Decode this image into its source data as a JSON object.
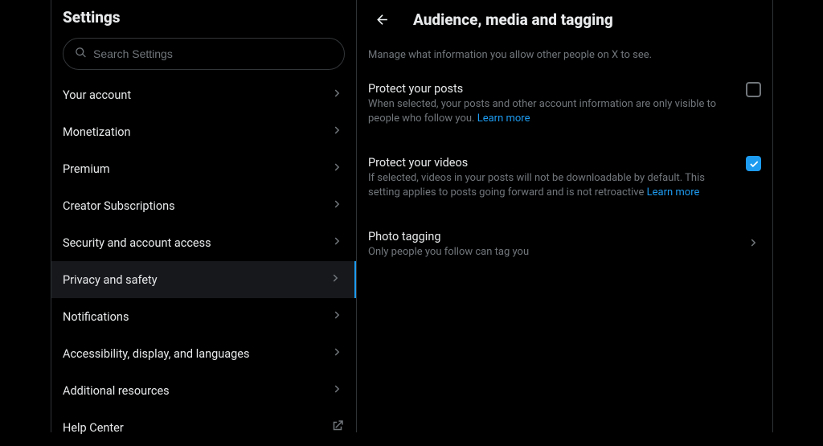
{
  "left": {
    "title": "Settings",
    "search_placeholder": "Search Settings",
    "items": [
      {
        "label": "Your account",
        "kind": "nav"
      },
      {
        "label": "Monetization",
        "kind": "nav"
      },
      {
        "label": "Premium",
        "kind": "nav"
      },
      {
        "label": "Creator Subscriptions",
        "kind": "nav"
      },
      {
        "label": "Security and account access",
        "kind": "nav"
      },
      {
        "label": "Privacy and safety",
        "kind": "nav",
        "active": true
      },
      {
        "label": "Notifications",
        "kind": "nav"
      },
      {
        "label": "Accessibility, display, and languages",
        "kind": "nav"
      },
      {
        "label": "Additional resources",
        "kind": "nav"
      },
      {
        "label": "Help Center",
        "kind": "ext"
      }
    ]
  },
  "right": {
    "title": "Audience, media and tagging",
    "subhead": "Manage what information you allow other people on X to see.",
    "protect_posts": {
      "title": "Protect your posts",
      "desc": "When selected, your posts and other account information are only visible to people who follow you. ",
      "learn_more": "Learn more",
      "checked": false
    },
    "protect_videos": {
      "title": "Protect your videos",
      "desc": "If selected, videos in your posts will not be downloadable by default. This setting applies to posts going forward and is not retroactive ",
      "learn_more": "Learn more",
      "checked": true
    },
    "photo_tagging": {
      "title": "Photo tagging",
      "desc": "Only people you follow can tag you"
    }
  }
}
